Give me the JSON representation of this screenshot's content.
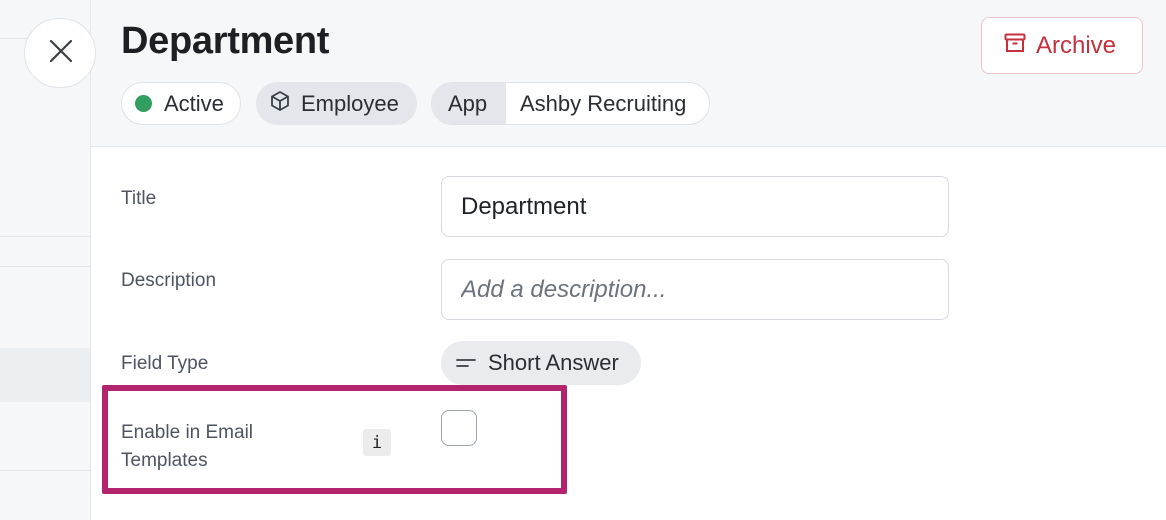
{
  "close": {
    "icon": "close-icon"
  },
  "header": {
    "title": "Department",
    "archive_label": "Archive",
    "archive_icon": "archive-box-icon",
    "status": {
      "label": "Active",
      "color": "#2f9e5f"
    },
    "object_type": {
      "label": "Employee",
      "icon": "cube-icon"
    },
    "source": {
      "prefix": "App",
      "name": "Ashby Recruiting"
    }
  },
  "form": {
    "title_field": {
      "label": "Title",
      "value": "Department"
    },
    "description_field": {
      "label": "Description",
      "placeholder": "Add a description..."
    },
    "field_type": {
      "label": "Field Type",
      "value": "Short Answer",
      "icon": "short-text-icon"
    },
    "email_templates": {
      "label_line1": "Enable in Email",
      "label_line2": "Templates",
      "info_glyph": "i",
      "checked": false
    }
  },
  "colors": {
    "accent_danger": "#c4313c",
    "highlight": "#b2246d"
  }
}
